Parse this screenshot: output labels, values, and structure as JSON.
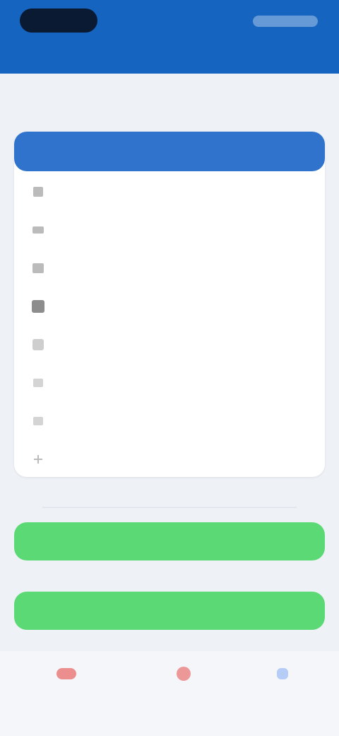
{
  "header": {
    "title": "",
    "right_text": "",
    "center_text": ""
  },
  "section": {
    "label": ""
  },
  "card": {
    "header_text": "",
    "items": [
      {
        "label": "",
        "icon": "document-icon"
      },
      {
        "label": "",
        "icon": "folder-icon"
      },
      {
        "label": "",
        "icon": "list-icon"
      },
      {
        "label": "",
        "icon": "square-icon"
      },
      {
        "label": "",
        "icon": "image-icon"
      },
      {
        "label": "",
        "icon": "box-icon"
      },
      {
        "label": "",
        "icon": "grid-icon"
      },
      {
        "label": "",
        "icon": "plus-icon"
      }
    ]
  },
  "buttons": {
    "primary": "",
    "secondary": ""
  },
  "bottom_nav": [
    {
      "label": "",
      "icon": "red-home-icon"
    },
    {
      "label": "",
      "icon": "red-chat-icon"
    },
    {
      "label": "",
      "icon": "blue-profile-icon"
    }
  ],
  "colors": {
    "header_blue": "#1565c0",
    "card_header_blue": "#2f73cc",
    "button_green": "#5ad974",
    "nav_red": "#e53935",
    "nav_blue": "#3f7df0"
  }
}
